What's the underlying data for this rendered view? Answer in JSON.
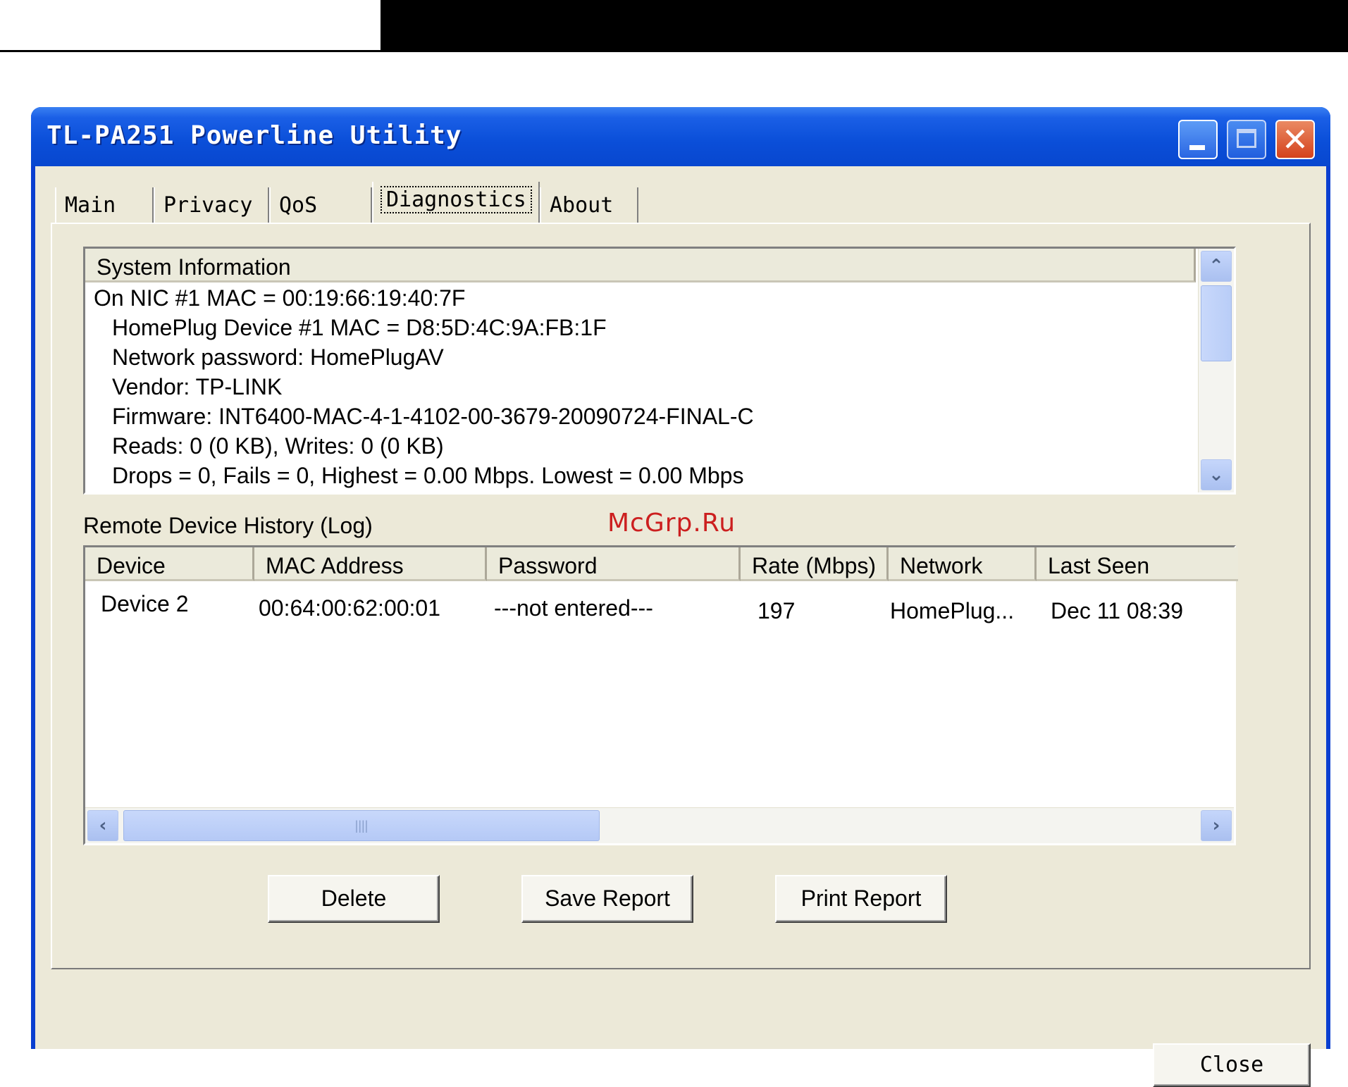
{
  "window": {
    "title": "TL-PA251 Powerline Utility"
  },
  "tabs": [
    {
      "label": "Main",
      "active": false
    },
    {
      "label": "Privacy",
      "active": false
    },
    {
      "label": "QoS",
      "active": false
    },
    {
      "label": "Diagnostics",
      "active": true
    },
    {
      "label": "About",
      "active": false
    }
  ],
  "system_info": {
    "header": "System Information",
    "lines": [
      "On NIC #1 MAC = 00:19:66:19:40:7F",
      "HomePlug Device #1 MAC = D8:5D:4C:9A:FB:1F",
      "Network password: HomePlugAV",
      "Vendor: TP-LINK",
      "Firmware: INT6400-MAC-4-1-4102-00-3679-20090724-FINAL-C",
      "Reads: 0 (0 KB), Writes: 0 (0 KB)",
      "Drops = 0, Fails = 0, Highest = 0.00 Mbps. Lowest = 0.00 Mbps"
    ]
  },
  "history": {
    "label": "Remote Device History (Log)",
    "columns": [
      "Device",
      "MAC Address",
      "Password",
      "Rate (Mbps)",
      "Network",
      "Last Seen"
    ],
    "rows": [
      [
        "Device 2",
        "00:64:00:62:00:01",
        "---not entered---",
        "197",
        "HomePlug...",
        "Dec 11 08:39"
      ]
    ]
  },
  "buttons": {
    "delete": "Delete",
    "save_report": "Save Report",
    "print_report": "Print Report",
    "close": "Close"
  },
  "icons": {
    "minimize": "minimize-icon",
    "maximize": "maximize-icon",
    "close": "close-icon",
    "scroll_up": "chevron-up-icon",
    "scroll_down": "chevron-down-icon",
    "scroll_left": "chevron-left-icon",
    "scroll_right": "chevron-right-icon"
  },
  "watermark": "McGrp.Ru",
  "colors": {
    "titlebar": "#0a4ed8",
    "client_bg": "#ece9d8",
    "close_button": "#d4421d",
    "watermark": "#cc1f1f"
  }
}
